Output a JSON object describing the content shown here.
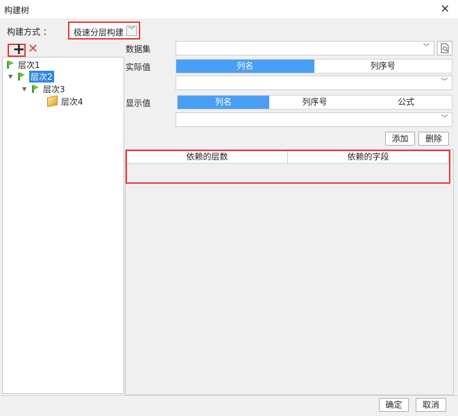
{
  "window": {
    "title": "构建树"
  },
  "method": {
    "label": "构建方式 ：",
    "value": "极速分层构建"
  },
  "tree": {
    "nodes": [
      {
        "label": "层次1",
        "selected": false
      },
      {
        "label": "层次2",
        "selected": true
      },
      {
        "label": "层次3",
        "selected": false
      },
      {
        "label": "层次4",
        "selected": false
      }
    ]
  },
  "dataset": {
    "label": "数据集",
    "value": ""
  },
  "actual": {
    "label": "实际值",
    "tabs": [
      "列名",
      "列序号"
    ],
    "active": 0,
    "value": ""
  },
  "display": {
    "label": "显示值",
    "tabs": [
      "列名",
      "列序号",
      "公式"
    ],
    "active": 0,
    "value": ""
  },
  "actions": {
    "add": "添加",
    "delete": "删除"
  },
  "table": {
    "columns": [
      "依赖的层数",
      "依赖的字段"
    ]
  },
  "footer": {
    "ok": "确定",
    "cancel": "取消"
  },
  "icons": {
    "close": "close-icon",
    "add": "plus-icon",
    "remove": "delete-x-icon",
    "level": "level-arrow-icon",
    "leaf": "cube-icon",
    "preview": "preview-icon"
  },
  "colors": {
    "accent": "#4a9ff5",
    "highlight": "#e53935"
  }
}
